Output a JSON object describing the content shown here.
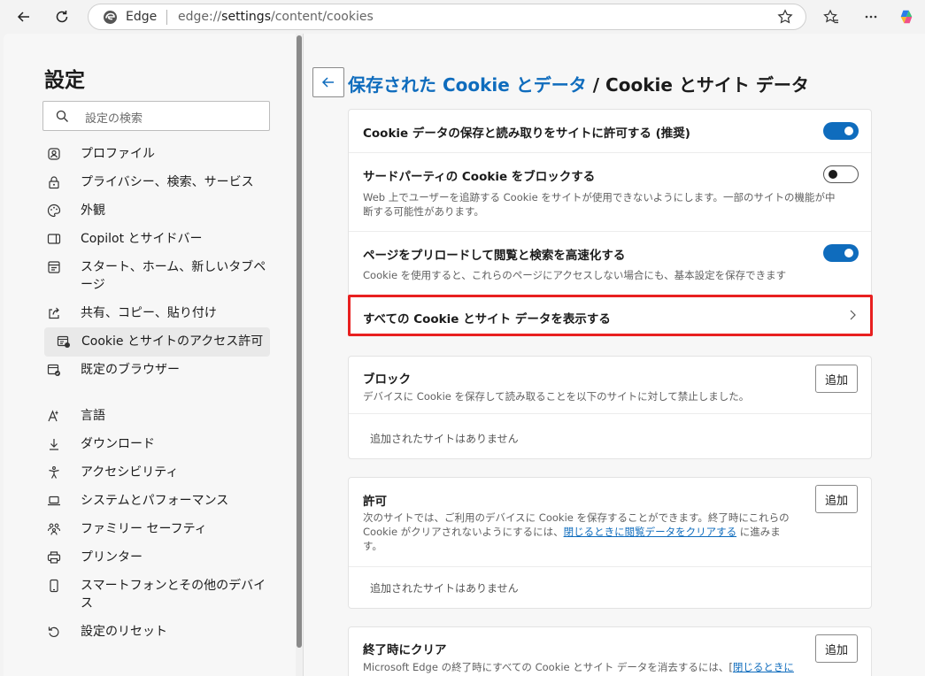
{
  "browser": {
    "brand": "Edge",
    "url_prefix": "edge://",
    "url_host": "settings",
    "url_path": "/content/cookies"
  },
  "sidebar": {
    "title": "設定",
    "search_placeholder": "設定の検索",
    "items": [
      {
        "label": "プロファイル",
        "icon": "profile-icon"
      },
      {
        "label": "プライバシー、検索、サービス",
        "icon": "lock-icon"
      },
      {
        "label": "外観",
        "icon": "palette-icon"
      },
      {
        "label": "Copilot とサイドバー",
        "icon": "sidebar-icon"
      },
      {
        "label": "スタート、ホーム、新しいタブページ",
        "icon": "home-tab-icon"
      },
      {
        "label": "共有、コピー、貼り付け",
        "icon": "share-icon"
      },
      {
        "label": "Cookie とサイトのアクセス許可",
        "icon": "cookie-permission-icon"
      },
      {
        "label": "既定のブラウザー",
        "icon": "browser-icon"
      },
      {
        "label": "言語",
        "icon": "language-icon"
      },
      {
        "label": "ダウンロード",
        "icon": "download-icon"
      },
      {
        "label": "アクセシビリティ",
        "icon": "accessibility-icon"
      },
      {
        "label": "システムとパフォーマンス",
        "icon": "laptop-icon"
      },
      {
        "label": "ファミリー セーフティ",
        "icon": "family-icon"
      },
      {
        "label": "プリンター",
        "icon": "printer-icon"
      },
      {
        "label": "スマートフォンとその他のデバイス",
        "icon": "phone-icon"
      },
      {
        "label": "設定のリセット",
        "icon": "reset-icon"
      }
    ]
  },
  "header": {
    "breadcrumb_link": "保存された Cookie とデータ",
    "breadcrumb_current": " / Cookie とサイト データ"
  },
  "settings_card": {
    "allow_title": "Cookie データの保存と読み取りをサイトに許可する (推奨)",
    "allow_on": true,
    "block_third_title": "サードパーティの Cookie をブロックする",
    "block_third_desc_1": "Web 上でユーザーを追跡する Cookie をサイトが使用できないようにします。一部のサイトの機能が中",
    "block_third_desc_2": "断する可能性があります。",
    "block_third_on": false,
    "preload_title": "ページをプリロードして閲覧と検索を高速化する",
    "preload_desc": "Cookie を使用すると、これらのページにアクセスしない場合にも、基本設定を保存できます",
    "preload_on": true,
    "see_all_title": "すべての Cookie とサイト データを表示する"
  },
  "block_card": {
    "title": "ブロック",
    "desc": "デバイスに Cookie を保存して読み取ることを以下のサイトに対して禁止しました。",
    "add_label": "追加",
    "empty": "追加されたサイトはありません"
  },
  "allow_card": {
    "title": "許可",
    "desc_1": "次のサイトでは、ご利用のデバイスに Cookie を保存することができます。終了時にこれらの",
    "desc_2a": "Cookie がクリアされないようにするには、",
    "desc_2_link": "閉じるときに閲覧データをクリアする",
    "desc_2b": " に進みま",
    "desc_3": "す。",
    "add_label": "追加",
    "empty": "追加されたサイトはありません"
  },
  "clear_card": {
    "title": "終了時にクリア",
    "desc_a": "Microsoft Edge の終了時にすべての Cookie とサイト データを消去するには、[",
    "desc_link": "閉じるときに",
    "add_label": "追加"
  }
}
